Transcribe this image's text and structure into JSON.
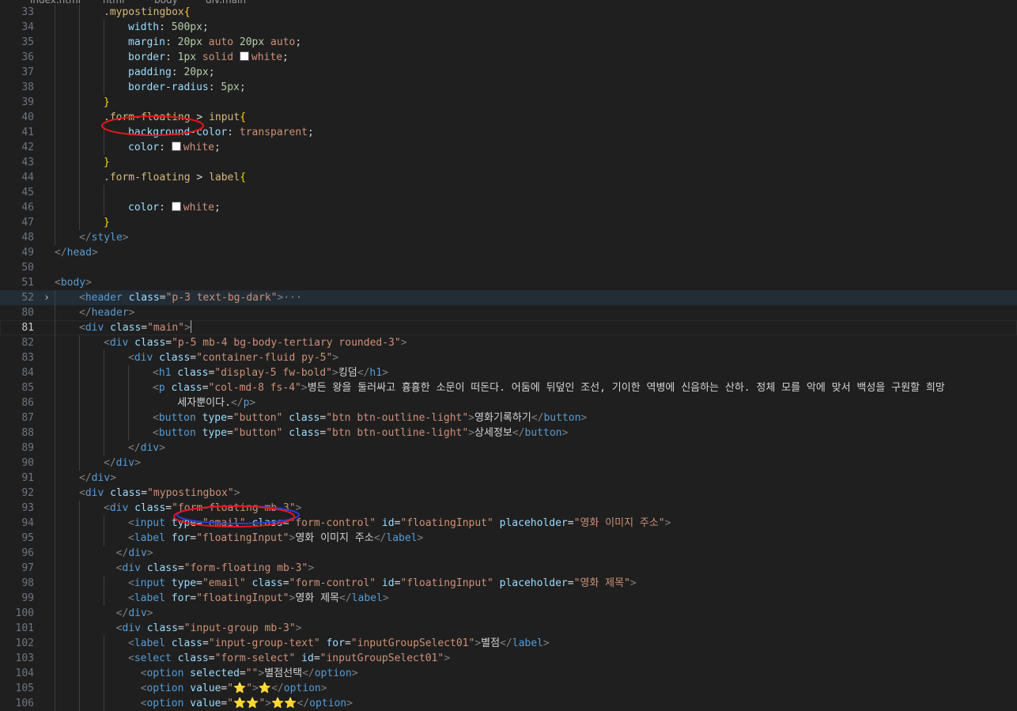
{
  "breadcrumb": [
    "index.html",
    "html",
    "body",
    "div.main"
  ],
  "editor": {
    "active_line": "81",
    "collapsed_line": "52"
  },
  "lines": [
    {
      "n": "33",
      "g": 2,
      "t": [
        [
          "sel",
          ".mypostingbox"
        ],
        [
          "cb",
          "{"
        ]
      ]
    },
    {
      "n": "34",
      "g": 3,
      "t": [
        [
          "pr",
          "width"
        ],
        [
          "pu",
          ": "
        ],
        [
          "nu",
          "500px"
        ],
        [
          "pu",
          ";"
        ]
      ]
    },
    {
      "n": "35",
      "g": 3,
      "t": [
        [
          "pr",
          "margin"
        ],
        [
          "pu",
          ": "
        ],
        [
          "nu",
          "20px"
        ],
        [
          "vl",
          " auto "
        ],
        [
          "nu",
          "20px"
        ],
        [
          "vl",
          " auto"
        ],
        [
          "pu",
          ";"
        ]
      ]
    },
    {
      "n": "36",
      "g": 3,
      "t": [
        [
          "pr",
          "border"
        ],
        [
          "pu",
          ": "
        ],
        [
          "nu",
          "1px"
        ],
        [
          "vl",
          " solid "
        ],
        [
          "sw",
          ""
        ],
        [
          "vl",
          "white"
        ],
        [
          "pu",
          ";"
        ]
      ]
    },
    {
      "n": "37",
      "g": 3,
      "t": [
        [
          "pr",
          "padding"
        ],
        [
          "pu",
          ": "
        ],
        [
          "nu",
          "20px"
        ],
        [
          "pu",
          ";"
        ]
      ]
    },
    {
      "n": "38",
      "g": 3,
      "t": [
        [
          "pr",
          "border-radius"
        ],
        [
          "pu",
          ": "
        ],
        [
          "nu",
          "5px"
        ],
        [
          "pu",
          ";"
        ]
      ]
    },
    {
      "n": "39",
      "g": 2,
      "t": [
        [
          "cb",
          "}"
        ]
      ]
    },
    {
      "n": "40",
      "g": 2,
      "t": [
        [
          "sel",
          ".form-floating"
        ],
        [
          "pu",
          " > "
        ],
        [
          "sel",
          "input"
        ],
        [
          "cb",
          "{"
        ]
      ]
    },
    {
      "n": "41",
      "g": 3,
      "t": [
        [
          "pr",
          "background-color"
        ],
        [
          "pu",
          ": "
        ],
        [
          "vl",
          "transparent"
        ],
        [
          "pu",
          ";"
        ]
      ]
    },
    {
      "n": "42",
      "g": 3,
      "t": [
        [
          "pr",
          "color"
        ],
        [
          "pu",
          ": "
        ],
        [
          "sw",
          ""
        ],
        [
          "vl",
          "white"
        ],
        [
          "pu",
          ";"
        ]
      ]
    },
    {
      "n": "43",
      "g": 2,
      "t": [
        [
          "cb",
          "}"
        ]
      ]
    },
    {
      "n": "44",
      "g": 2,
      "t": [
        [
          "sel",
          ".form-floating"
        ],
        [
          "pu",
          " > "
        ],
        [
          "sel",
          "label"
        ],
        [
          "cb",
          "{"
        ]
      ]
    },
    {
      "n": "45",
      "g": 3,
      "t": []
    },
    {
      "n": "46",
      "g": 3,
      "t": [
        [
          "pr",
          "color"
        ],
        [
          "pu",
          ": "
        ],
        [
          "sw",
          ""
        ],
        [
          "vl",
          "white"
        ],
        [
          "pu",
          ";"
        ]
      ]
    },
    {
      "n": "47",
      "g": 2,
      "t": [
        [
          "cb",
          "}"
        ]
      ]
    },
    {
      "n": "48",
      "g": 1,
      "t": [
        [
          "br",
          "</"
        ],
        [
          "tag",
          "style"
        ],
        [
          "br",
          ">"
        ]
      ]
    },
    {
      "n": "49",
      "g": 0,
      "t": [
        [
          "br",
          "</"
        ],
        [
          "tag",
          "head"
        ],
        [
          "br",
          ">"
        ]
      ]
    },
    {
      "n": "50",
      "g": 0,
      "t": []
    },
    {
      "n": "51",
      "g": 0,
      "t": [
        [
          "br",
          "<"
        ],
        [
          "tag",
          "body"
        ],
        [
          "br",
          ">"
        ]
      ]
    },
    {
      "n": "52",
      "g": 1,
      "t": [
        [
          "br",
          "<"
        ],
        [
          "tag",
          "header"
        ],
        [
          "at",
          " class"
        ],
        [
          "tx",
          "="
        ],
        [
          "st",
          "\"p-3 text-bg-dark\""
        ],
        [
          "br",
          ">"
        ],
        [
          "el",
          "···"
        ]
      ]
    },
    {
      "n": "80",
      "g": 1,
      "t": [
        [
          "br",
          "</"
        ],
        [
          "tag",
          "header"
        ],
        [
          "br",
          ">"
        ]
      ]
    },
    {
      "n": "81",
      "g": 1,
      "t": [
        [
          "br",
          "<"
        ],
        [
          "tag",
          "div"
        ],
        [
          "at",
          " class"
        ],
        [
          "tx",
          "="
        ],
        [
          "st",
          "\"main\""
        ],
        [
          "br",
          ">"
        ],
        [
          "caret",
          ""
        ]
      ]
    },
    {
      "n": "82",
      "g": 2,
      "t": [
        [
          "br",
          "<"
        ],
        [
          "tag",
          "div"
        ],
        [
          "at",
          " class"
        ],
        [
          "tx",
          "="
        ],
        [
          "st",
          "\"p-5 mb-4 bg-body-tertiary rounded-3\""
        ],
        [
          "br",
          ">"
        ]
      ]
    },
    {
      "n": "83",
      "g": 3,
      "t": [
        [
          "br",
          "<"
        ],
        [
          "tag",
          "div"
        ],
        [
          "at",
          " class"
        ],
        [
          "tx",
          "="
        ],
        [
          "st",
          "\"container-fluid py-5\""
        ],
        [
          "br",
          ">"
        ]
      ]
    },
    {
      "n": "84",
      "g": 4,
      "t": [
        [
          "br",
          "<"
        ],
        [
          "tag",
          "h1"
        ],
        [
          "at",
          " class"
        ],
        [
          "tx",
          "="
        ],
        [
          "st",
          "\"display-5 fw-bold\""
        ],
        [
          "br",
          ">"
        ],
        [
          "tx",
          "킹덤"
        ],
        [
          "br",
          "</"
        ],
        [
          "tag",
          "h1"
        ],
        [
          "br",
          ">"
        ]
      ]
    },
    {
      "n": "85",
      "g": 4,
      "t": [
        [
          "br",
          "<"
        ],
        [
          "tag",
          "p"
        ],
        [
          "at",
          " class"
        ],
        [
          "tx",
          "="
        ],
        [
          "st",
          "\"col-md-8 fs-4\""
        ],
        [
          "br",
          ">"
        ],
        [
          "tx",
          "병든 왕을 둘러싸고 흉흉한 소문이 떠돈다. 어둠에 뒤덮인 조선, 기이한 역병에 신음하는 산하. 정체 모를 악에 맞서 백성을 구원할 희망"
        ]
      ]
    },
    {
      "n": "86",
      "g": 4,
      "t": [
        [
          "tx",
          "    세자뿐이다."
        ],
        [
          "br",
          "</"
        ],
        [
          "tag",
          "p"
        ],
        [
          "br",
          ">"
        ]
      ]
    },
    {
      "n": "87",
      "g": 4,
      "t": [
        [
          "br",
          "<"
        ],
        [
          "tag",
          "button"
        ],
        [
          "at",
          " type"
        ],
        [
          "tx",
          "="
        ],
        [
          "st",
          "\"button\""
        ],
        [
          "at",
          " class"
        ],
        [
          "tx",
          "="
        ],
        [
          "st",
          "\"btn btn-outline-light\""
        ],
        [
          "br",
          ">"
        ],
        [
          "tx",
          "영화기록하기"
        ],
        [
          "br",
          "</"
        ],
        [
          "tag",
          "button"
        ],
        [
          "br",
          ">"
        ]
      ]
    },
    {
      "n": "88",
      "g": 4,
      "t": [
        [
          "br",
          "<"
        ],
        [
          "tag",
          "button"
        ],
        [
          "at",
          " type"
        ],
        [
          "tx",
          "="
        ],
        [
          "st",
          "\"button\""
        ],
        [
          "at",
          " class"
        ],
        [
          "tx",
          "="
        ],
        [
          "st",
          "\"btn btn-outline-light\""
        ],
        [
          "br",
          ">"
        ],
        [
          "tx",
          "상세정보"
        ],
        [
          "br",
          "</"
        ],
        [
          "tag",
          "button"
        ],
        [
          "br",
          ">"
        ]
      ]
    },
    {
      "n": "89",
      "g": 3,
      "t": [
        [
          "br",
          "</"
        ],
        [
          "tag",
          "div"
        ],
        [
          "br",
          ">"
        ]
      ]
    },
    {
      "n": "90",
      "g": 2,
      "t": [
        [
          "br",
          "</"
        ],
        [
          "tag",
          "div"
        ],
        [
          "br",
          ">"
        ]
      ]
    },
    {
      "n": "91",
      "g": 1,
      "t": [
        [
          "br",
          "</"
        ],
        [
          "tag",
          "div"
        ],
        [
          "br",
          ">"
        ]
      ]
    },
    {
      "n": "92",
      "g": 1,
      "t": [
        [
          "br",
          "<"
        ],
        [
          "tag",
          "div"
        ],
        [
          "at",
          " class"
        ],
        [
          "tx",
          "="
        ],
        [
          "st",
          "\"mypostingbox\""
        ],
        [
          "br",
          ">"
        ]
      ]
    },
    {
      "n": "93",
      "g": 2,
      "t": [
        [
          "br",
          "<"
        ],
        [
          "tag",
          "div"
        ],
        [
          "at",
          " class"
        ],
        [
          "tx",
          "="
        ],
        [
          "st",
          "\"form-floating mb-3\""
        ],
        [
          "br",
          ">"
        ]
      ]
    },
    {
      "n": "94",
      "g": 3,
      "t": [
        [
          "br",
          "<"
        ],
        [
          "tag",
          "input"
        ],
        [
          "at",
          " type"
        ],
        [
          "tx",
          "="
        ],
        [
          "st",
          "\"email\""
        ],
        [
          "at",
          " class"
        ],
        [
          "tx",
          "="
        ],
        [
          "st",
          "\"form-control\""
        ],
        [
          "at",
          " id"
        ],
        [
          "tx",
          "="
        ],
        [
          "st",
          "\"floatingInput\""
        ],
        [
          "at",
          " placeholder"
        ],
        [
          "tx",
          "="
        ],
        [
          "st",
          "\"영화 이미지 주소\""
        ],
        [
          "br",
          ">"
        ]
      ]
    },
    {
      "n": "95",
      "g": 3,
      "t": [
        [
          "br",
          "<"
        ],
        [
          "tag",
          "label"
        ],
        [
          "at",
          " for"
        ],
        [
          "tx",
          "="
        ],
        [
          "st",
          "\"floatingInput\""
        ],
        [
          "br",
          ">"
        ],
        [
          "tx",
          "영화 이미지 주소"
        ],
        [
          "br",
          "</"
        ],
        [
          "tag",
          "label"
        ],
        [
          "br",
          ">"
        ]
      ]
    },
    {
      "n": "96",
      "g": 2,
      "t": [
        [
          "tx",
          "  "
        ],
        [
          "br",
          "</"
        ],
        [
          "tag",
          "div"
        ],
        [
          "br",
          ">"
        ]
      ]
    },
    {
      "n": "97",
      "g": 2,
      "t": [
        [
          "tx",
          "  "
        ],
        [
          "br",
          "<"
        ],
        [
          "tag",
          "div"
        ],
        [
          "at",
          " class"
        ],
        [
          "tx",
          "="
        ],
        [
          "st",
          "\"form-floating mb-3\""
        ],
        [
          "br",
          ">"
        ]
      ]
    },
    {
      "n": "98",
      "g": 3,
      "t": [
        [
          "br",
          "<"
        ],
        [
          "tag",
          "input"
        ],
        [
          "at",
          " type"
        ],
        [
          "tx",
          "="
        ],
        [
          "st",
          "\"email\""
        ],
        [
          "at",
          " class"
        ],
        [
          "tx",
          "="
        ],
        [
          "st",
          "\"form-control\""
        ],
        [
          "at",
          " id"
        ],
        [
          "tx",
          "="
        ],
        [
          "st",
          "\"floatingInput\""
        ],
        [
          "at",
          " placeholder"
        ],
        [
          "tx",
          "="
        ],
        [
          "st",
          "\"영화 제목\""
        ],
        [
          "br",
          ">"
        ]
      ]
    },
    {
      "n": "99",
      "g": 3,
      "t": [
        [
          "br",
          "<"
        ],
        [
          "tag",
          "label"
        ],
        [
          "at",
          " for"
        ],
        [
          "tx",
          "="
        ],
        [
          "st",
          "\"floatingInput\""
        ],
        [
          "br",
          ">"
        ],
        [
          "tx",
          "영화 제목"
        ],
        [
          "br",
          "</"
        ],
        [
          "tag",
          "label"
        ],
        [
          "br",
          ">"
        ]
      ]
    },
    {
      "n": "100",
      "g": 2,
      "t": [
        [
          "tx",
          "  "
        ],
        [
          "br",
          "</"
        ],
        [
          "tag",
          "div"
        ],
        [
          "br",
          ">"
        ]
      ]
    },
    {
      "n": "101",
      "g": 2,
      "t": [
        [
          "tx",
          "  "
        ],
        [
          "br",
          "<"
        ],
        [
          "tag",
          "div"
        ],
        [
          "at",
          " class"
        ],
        [
          "tx",
          "="
        ],
        [
          "st",
          "\"input-group mb-3\""
        ],
        [
          "br",
          ">"
        ]
      ]
    },
    {
      "n": "102",
      "g": 3,
      "t": [
        [
          "br",
          "<"
        ],
        [
          "tag",
          "label"
        ],
        [
          "at",
          " class"
        ],
        [
          "tx",
          "="
        ],
        [
          "st",
          "\"input-group-text\""
        ],
        [
          "at",
          " for"
        ],
        [
          "tx",
          "="
        ],
        [
          "st",
          "\"inputGroupSelect01\""
        ],
        [
          "br",
          ">"
        ],
        [
          "tx",
          "별점"
        ],
        [
          "br",
          "</"
        ],
        [
          "tag",
          "label"
        ],
        [
          "br",
          ">"
        ]
      ]
    },
    {
      "n": "103",
      "g": 3,
      "t": [
        [
          "br",
          "<"
        ],
        [
          "tag",
          "select"
        ],
        [
          "at",
          " class"
        ],
        [
          "tx",
          "="
        ],
        [
          "st",
          "\"form-select\""
        ],
        [
          "at",
          " id"
        ],
        [
          "tx",
          "="
        ],
        [
          "st",
          "\"inputGroupSelect01\""
        ],
        [
          "br",
          ">"
        ]
      ]
    },
    {
      "n": "104",
      "g": 3,
      "t": [
        [
          "tx",
          "  "
        ],
        [
          "br",
          "<"
        ],
        [
          "tag",
          "option"
        ],
        [
          "at",
          " selected"
        ],
        [
          "tx",
          "="
        ],
        [
          "st",
          "\"\""
        ],
        [
          "br",
          ">"
        ],
        [
          "tx",
          "별점선택"
        ],
        [
          "br",
          "</"
        ],
        [
          "tag",
          "option"
        ],
        [
          "br",
          ">"
        ]
      ]
    },
    {
      "n": "105",
      "g": 3,
      "t": [
        [
          "tx",
          "  "
        ],
        [
          "br",
          "<"
        ],
        [
          "tag",
          "option"
        ],
        [
          "at",
          " value"
        ],
        [
          "tx",
          "="
        ],
        [
          "st",
          "\"⭐\""
        ],
        [
          "br",
          ">"
        ],
        [
          "tx",
          "⭐"
        ],
        [
          "br",
          "</"
        ],
        [
          "tag",
          "option"
        ],
        [
          "br",
          ">"
        ]
      ]
    },
    {
      "n": "106",
      "g": 3,
      "t": [
        [
          "tx",
          "  "
        ],
        [
          "br",
          "<"
        ],
        [
          "tag",
          "option"
        ],
        [
          "at",
          " value"
        ],
        [
          "tx",
          "="
        ],
        [
          "st",
          "\"⭐⭐\""
        ],
        [
          "br",
          ">"
        ],
        [
          "tx",
          "⭐⭐"
        ],
        [
          "br",
          "</"
        ],
        [
          "tag",
          "option"
        ],
        [
          "br",
          ">"
        ]
      ]
    }
  ],
  "annotations": {
    "color": "#e8141a",
    "accent_color": "#2a3fd6"
  }
}
